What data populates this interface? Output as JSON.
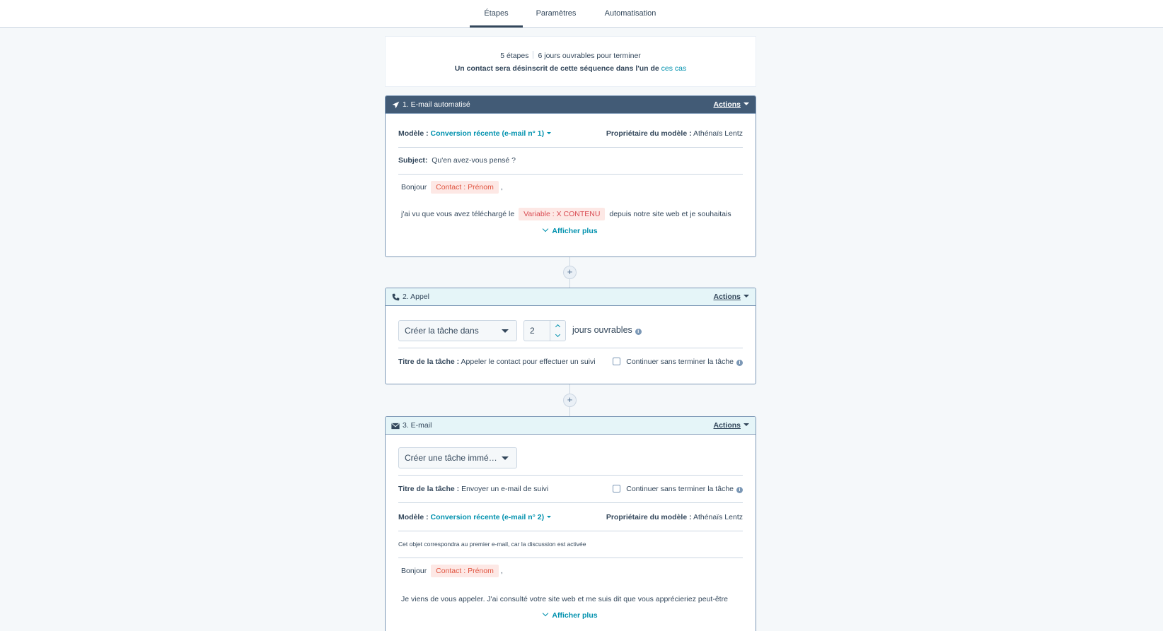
{
  "tabs": [
    {
      "label": "Étapes"
    },
    {
      "label": "Paramètres"
    },
    {
      "label": "Automatisation"
    }
  ],
  "summary": {
    "steps": "5 étapes",
    "days": "6 jours ouvrables pour terminer",
    "unenroll_text": "Un contact sera désinscrit de cette séquence dans l'un de",
    "unenroll_link": "ces cas"
  },
  "steps": [
    {
      "title": "1. E-mail automatisé",
      "actions": "Actions",
      "template_label": "Modèle :",
      "template_value": "Conversion récente (e-mail n° 1)",
      "owner_label": "Propriétaire du modèle :",
      "owner_value": "Athénaïs Lentz",
      "subject_label": "Subject:",
      "subject_value": "Qu'en avez-vous pensé ?",
      "greeting": "Bonjour",
      "greeting_token": "Contact : Prénom",
      "greeting_end": ",",
      "body_start": "j'ai vu que vous avez téléchargé le",
      "body_token": "Variable : X CONTENU",
      "body_end": "depuis notre site web et je souhaitais",
      "show_more": "Afficher plus"
    },
    {
      "title": "2. Appel",
      "actions": "Actions",
      "task_select": "Créer la tâche dans",
      "delay_value": "2",
      "delay_unit": "jours ouvrables",
      "task_title_label": "Titre de la tâche :",
      "task_title_value": "Appeler le contact pour effectuer un suivi",
      "continue_label": "Continuer sans terminer la tâche"
    },
    {
      "title": "3. E-mail",
      "actions": "Actions",
      "task_select": "Créer une tâche immé…",
      "task_title_label": "Titre de la tâche :",
      "task_title_value": "Envoyer un e-mail de suivi",
      "continue_label": "Continuer sans terminer la tâche",
      "template_label": "Modèle :",
      "template_value": "Conversion récente (e-mail n° 2)",
      "owner_label": "Propriétaire du modèle :",
      "owner_value": "Athénaïs Lentz",
      "thread_note": "Cet objet correspondra au premier e-mail, car la discussion est activée",
      "greeting": "Bonjour",
      "greeting_token": "Contact : Prénom",
      "greeting_end": ",",
      "body": "Je viens de vous appeler. J'ai consulté votre site web et me suis dit que vous apprécieriez peut-être",
      "show_more": "Afficher plus"
    }
  ],
  "icons": {
    "step1": "paper-plane-icon",
    "step2": "phone-icon",
    "step3": "envelope-icon",
    "info": "info-icon",
    "add": "plus-icon"
  },
  "colors": {
    "accent": "#0091ae",
    "header_dark": "#425b76",
    "header_light": "#e5f5f8",
    "token_bg": "#fde8e5",
    "token_text": "#e0533f"
  }
}
